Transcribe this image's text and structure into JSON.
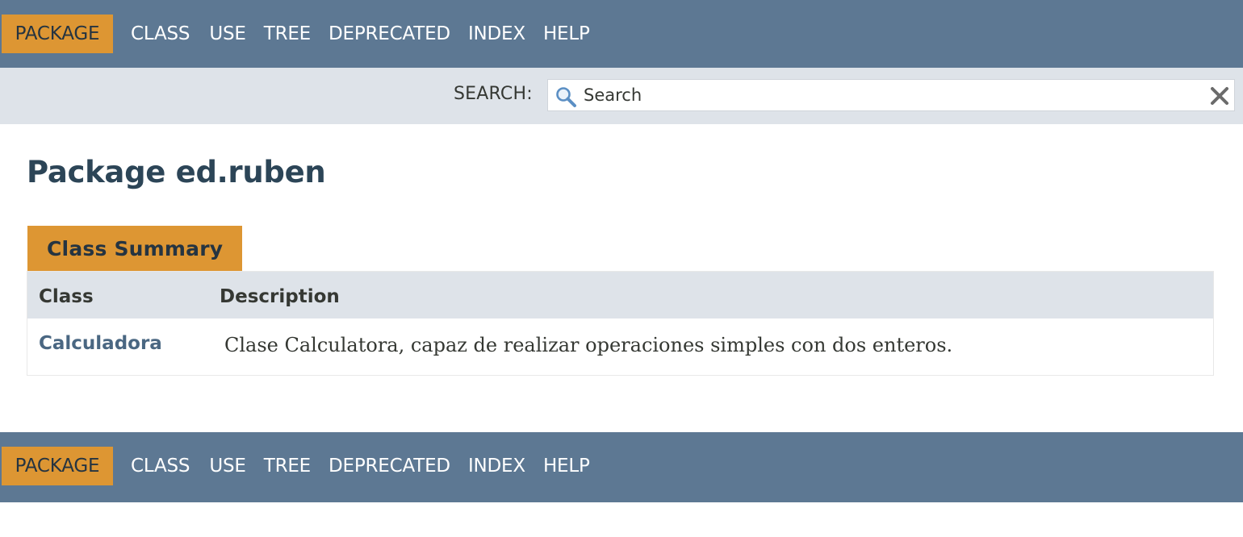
{
  "top_nav": {
    "active": "PACKAGE",
    "links": [
      "CLASS",
      "USE",
      "TREE",
      "DEPRECATED",
      "INDEX",
      "HELP"
    ]
  },
  "search": {
    "label": "SEARCH:",
    "placeholder": "Search",
    "icon": "search-icon",
    "reset_icon": "close-icon"
  },
  "page": {
    "title": "Package ed.ruben"
  },
  "class_summary": {
    "caption": "Class Summary",
    "headers": [
      "Class",
      "Description"
    ],
    "rows": [
      {
        "class": "Calculadora",
        "description": "Clase Calculatora, capaz de realizar operaciones simples con dos enteros."
      }
    ]
  },
  "bottom_nav": {
    "active": "PACKAGE",
    "links": [
      "CLASS",
      "USE",
      "TREE",
      "DEPRECATED",
      "INDEX",
      "HELP"
    ]
  },
  "colors": {
    "nav_bg": "#5d7893",
    "accent": "#dd9633",
    "subnav_bg": "#dee3e9",
    "link": "#4a6782",
    "title": "#2c4557"
  }
}
